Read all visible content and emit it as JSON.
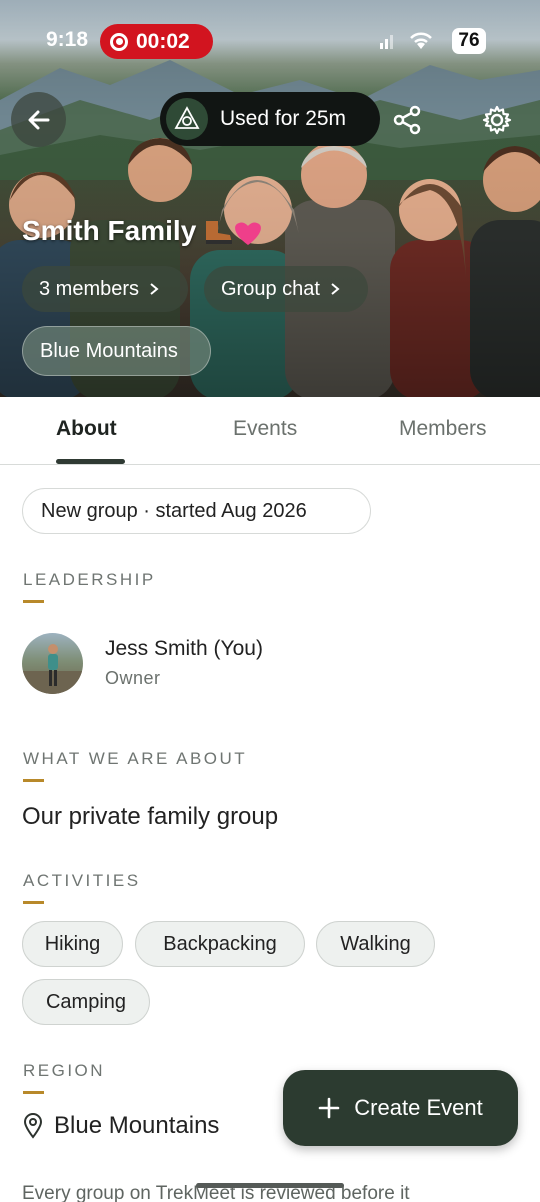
{
  "status_bar": {
    "time": "9:18",
    "recording_time": "00:02",
    "battery": "76"
  },
  "hero": {
    "usage_label": "Used for 25m",
    "group_name": "Smith Family",
    "members_chip": "3 members",
    "chat_chip": "Group chat",
    "region_chip": "Blue Mountains"
  },
  "tabs": [
    "About",
    "Events",
    "Members"
  ],
  "about": {
    "status_pill": "New group · started Aug 2026",
    "leadership_label": "LEADERSHIP",
    "leader_name": "Jess Smith (You)",
    "leader_role": "Owner",
    "what_label": "WHAT WE ARE ABOUT",
    "what_text": "Our private family group",
    "activities_label": "ACTIVITIES",
    "activities": [
      "Hiking",
      "Backpacking",
      "Walking",
      "Camping"
    ],
    "region_label": "REGION",
    "region": "Blue Mountains",
    "footer": "Every group on TrekMeet is reviewed before it"
  },
  "fab": {
    "label": "Create Event"
  },
  "colors": {
    "accent": "#b8892a",
    "fab": "#2c3b30",
    "record": "#d2141f"
  }
}
